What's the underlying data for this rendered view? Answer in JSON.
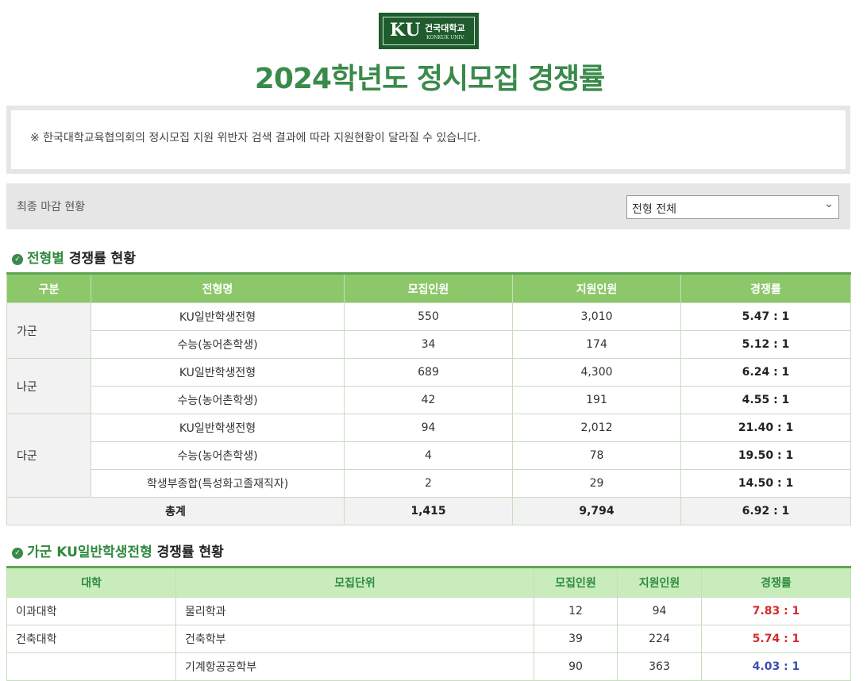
{
  "logo": {
    "mark": "KU",
    "kr": "건국대학교",
    "en": "KONKUK UNIV."
  },
  "title": "2024학년도 정시모집 경쟁률",
  "notice": "※ 한국대학교육협의회의 정시모집 지원 위반자 검색 결과에 따라 지원현황이 달라질 수 있습니다.",
  "filter": {
    "label": "최종 마감 현황",
    "selected": "전형 전체"
  },
  "section1": {
    "highlight": "전형별",
    "rest": " 경쟁률 현황"
  },
  "table1": {
    "headers": [
      "구분",
      "전형명",
      "모집인원",
      "지원인원",
      "경쟁률"
    ],
    "groups": [
      {
        "name": "가군",
        "rows": [
          {
            "type": "KU일반학생전형",
            "quota": "550",
            "applicants": "3,010",
            "rate": "5.47 : 1"
          },
          {
            "type": "수능(농어촌학생)",
            "quota": "34",
            "applicants": "174",
            "rate": "5.12 : 1"
          }
        ]
      },
      {
        "name": "나군",
        "rows": [
          {
            "type": "KU일반학생전형",
            "quota": "689",
            "applicants": "4,300",
            "rate": "6.24 : 1"
          },
          {
            "type": "수능(농어촌학생)",
            "quota": "42",
            "applicants": "191",
            "rate": "4.55 : 1"
          }
        ]
      },
      {
        "name": "다군",
        "rows": [
          {
            "type": "KU일반학생전형",
            "quota": "94",
            "applicants": "2,012",
            "rate": "21.40 : 1"
          },
          {
            "type": "수능(농어촌학생)",
            "quota": "4",
            "applicants": "78",
            "rate": "19.50 : 1"
          },
          {
            "type": "학생부종합(특성화고졸재직자)",
            "quota": "2",
            "applicants": "29",
            "rate": "14.50 : 1"
          }
        ]
      }
    ],
    "total": {
      "label": "총계",
      "quota": "1,415",
      "applicants": "9,794",
      "rate": "6.92 : 1"
    }
  },
  "section2": {
    "highlight": "가군 KU일반학생전형",
    "rest": " 경쟁률 현황"
  },
  "table2": {
    "headers": [
      "대학",
      "모집단위",
      "모집인원",
      "지원인원",
      "경쟁률"
    ],
    "rows": [
      {
        "college": "이과대학",
        "unit": "물리학과",
        "quota": "12",
        "applicants": "94",
        "rate": "7.83 : 1",
        "color": "#d42a2a"
      },
      {
        "college": "건축대학",
        "unit": "건축학부",
        "quota": "39",
        "applicants": "224",
        "rate": "5.74 : 1",
        "color": "#d42a2a"
      },
      {
        "college": "",
        "unit": "기계항공공학부",
        "quota": "90",
        "applicants": "363",
        "rate": "4.03 : 1",
        "color": "#3a4fb0"
      }
    ]
  }
}
